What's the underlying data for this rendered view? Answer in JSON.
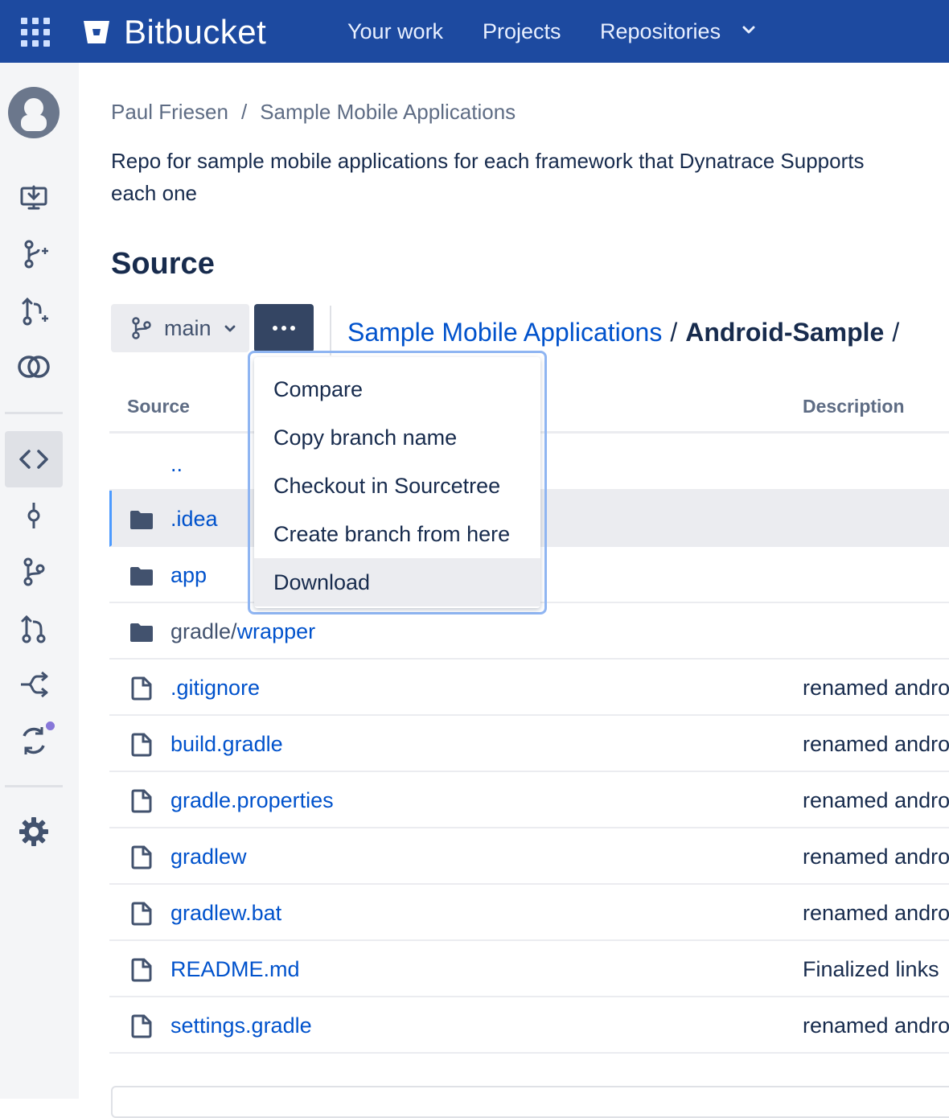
{
  "header": {
    "brand": "Bitbucket",
    "nav": [
      "Your work",
      "Projects",
      "Repositories"
    ],
    "colors": {
      "bar": "#1d4aa0",
      "link": "#0052cc"
    }
  },
  "sidebar": {
    "icons": [
      "avatar-icon",
      "clone-icon",
      "create-branch-icon",
      "create-pr-icon",
      "compare-icon",
      "source-icon",
      "commits-icon",
      "branches-icon",
      "pull-requests-icon",
      "pipelines-icon",
      "deployments-icon",
      "settings-icon"
    ],
    "active": "source-icon"
  },
  "breadcrumb": {
    "owner": "Paul Friesen",
    "separator": "/",
    "repo": "Sample Mobile Applications"
  },
  "repo_description": {
    "line1": "Repo for sample mobile applications for each framework that Dynatrace Supports",
    "line2": "each one"
  },
  "page_title": "Source",
  "branch": {
    "name": "main"
  },
  "path": {
    "root": "Sample Mobile Applications",
    "sep": "/",
    "current": "Android-Sample",
    "trail": "/"
  },
  "table": {
    "headers": {
      "source": "Source",
      "description": "Description"
    },
    "rows": [
      {
        "type": "parent",
        "name": "..",
        "commit": ""
      },
      {
        "type": "folder",
        "name": ".idea",
        "commit": ""
      },
      {
        "type": "folder",
        "name": "app",
        "commit": ""
      },
      {
        "type": "folder",
        "prefix": "gradle/",
        "name": "wrapper",
        "commit": ""
      },
      {
        "type": "file",
        "name": ".gitignore",
        "commit": "renamed andro"
      },
      {
        "type": "file",
        "name": "build.gradle",
        "commit": "renamed andro"
      },
      {
        "type": "file",
        "name": "gradle.properties",
        "commit": "renamed andro"
      },
      {
        "type": "file",
        "name": "gradlew",
        "commit": "renamed andro"
      },
      {
        "type": "file",
        "name": "gradlew.bat",
        "commit": "renamed andro"
      },
      {
        "type": "file",
        "name": "README.md",
        "commit": "Finalized links"
      },
      {
        "type": "file",
        "name": "settings.gradle",
        "commit": "renamed andro"
      }
    ]
  },
  "dropdown": {
    "items": [
      "Compare",
      "Copy branch name",
      "Checkout in Sourcetree",
      "Create branch from here",
      "Download"
    ],
    "highlighted": "Download"
  }
}
